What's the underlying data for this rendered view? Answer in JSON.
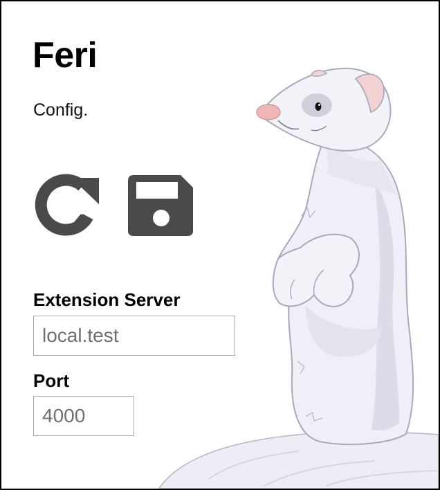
{
  "app": {
    "title": "Feri",
    "subtitle": "Config."
  },
  "actions": {
    "reload_icon": "reload-icon",
    "save_icon": "floppy-disk-icon",
    "icon_color": "#4a4a4a"
  },
  "form": {
    "server": {
      "label": "Extension Server",
      "placeholder": "local.test",
      "value": ""
    },
    "port": {
      "label": "Port",
      "placeholder": "4000",
      "value": ""
    }
  },
  "illustration": {
    "subject": "ferret-mascot",
    "fur_color": "#eeeef6",
    "shade_color": "#d9d9e6",
    "outline_color": "#a9a9bd",
    "nose_color": "#f0b6b6"
  }
}
